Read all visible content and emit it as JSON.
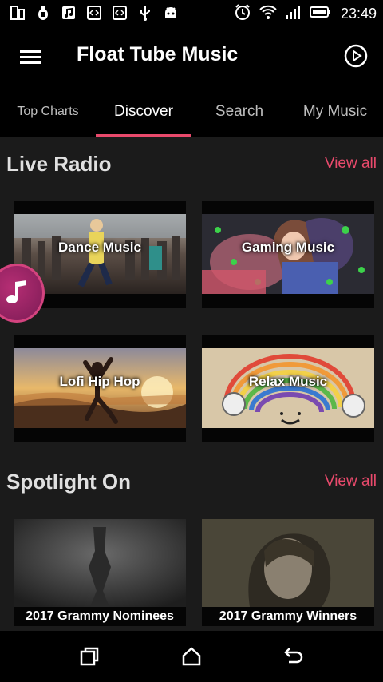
{
  "status_bar": {
    "time": "23:49",
    "left_icons": [
      "sim-toolkit-icon",
      "android-debug-icon",
      "music-note-icon",
      "code-icon",
      "code-icon",
      "usb-icon",
      "android-icon"
    ],
    "right_icons": [
      "alarm-icon",
      "wifi-icon",
      "signal-icon",
      "battery-icon"
    ]
  },
  "app_bar": {
    "title": "Float Tube Music",
    "menu_icon": "hamburger-menu-icon",
    "action_icon": "play-circle-icon"
  },
  "tabs": [
    {
      "label": "Top Charts",
      "active": false
    },
    {
      "label": "Discover",
      "active": true
    },
    {
      "label": "Search",
      "active": false
    },
    {
      "label": "My Music",
      "active": false
    }
  ],
  "accent_color": "#e94a6c",
  "live_radio": {
    "title": "Live Radio",
    "view_all": "View all",
    "items": [
      {
        "label": "Dance Music"
      },
      {
        "label": "Gaming Music"
      },
      {
        "label": "Lofi Hip Hop"
      },
      {
        "label": "Relax Music"
      }
    ]
  },
  "spotlight": {
    "title": "Spotlight On",
    "view_all": "View all",
    "items": [
      {
        "label": "2017 Grammy Nominees"
      },
      {
        "label": "2017 Grammy Winners"
      }
    ]
  },
  "fab": {
    "icon": "music-note-icon"
  },
  "nav_bar": {
    "buttons": [
      "recents-icon",
      "home-icon",
      "back-icon"
    ]
  }
}
